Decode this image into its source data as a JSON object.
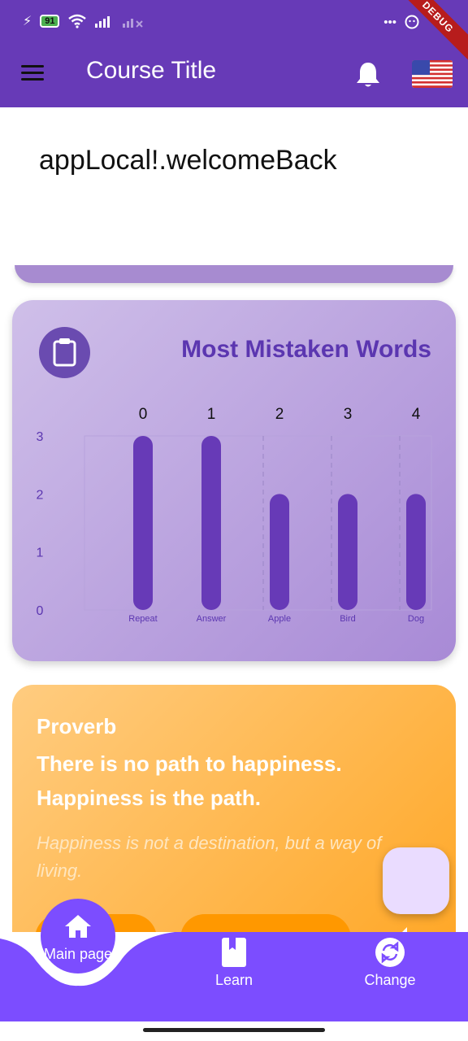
{
  "status_bar": {
    "battery": "91",
    "debug_banner": "DEBUG"
  },
  "app_bar": {
    "title": "Course Title"
  },
  "welcome": {
    "text": "appLocal!.welcomeBack"
  },
  "chart_card": {
    "title": "Most Mistaken Words",
    "chart_data": {
      "type": "bar",
      "categories": [
        "Repeat",
        "Answer",
        "Apple",
        "Bird",
        "Dog"
      ],
      "top_labels": [
        "0",
        "1",
        "2",
        "3",
        "4"
      ],
      "values": [
        3,
        3,
        2,
        2,
        2
      ],
      "ylim": [
        0,
        3
      ],
      "yticks": [
        "0",
        "1",
        "2",
        "3"
      ],
      "bar_color": "#673ab7",
      "grid": true
    }
  },
  "proverb": {
    "heading": "Proverb",
    "text": "There is no path to happiness. Happiness is the path.",
    "meaning": "Happiness is not a destination, but a way of living."
  },
  "bottom_nav": {
    "items": [
      {
        "label": "Main page",
        "icon": "home-icon"
      },
      {
        "label": "Learn",
        "icon": "book-icon"
      },
      {
        "label": "Change",
        "icon": "sync-icon"
      }
    ]
  },
  "colors": {
    "primary": "#673ab7",
    "nav": "#7c4dff",
    "proverb": "#ffa726"
  }
}
